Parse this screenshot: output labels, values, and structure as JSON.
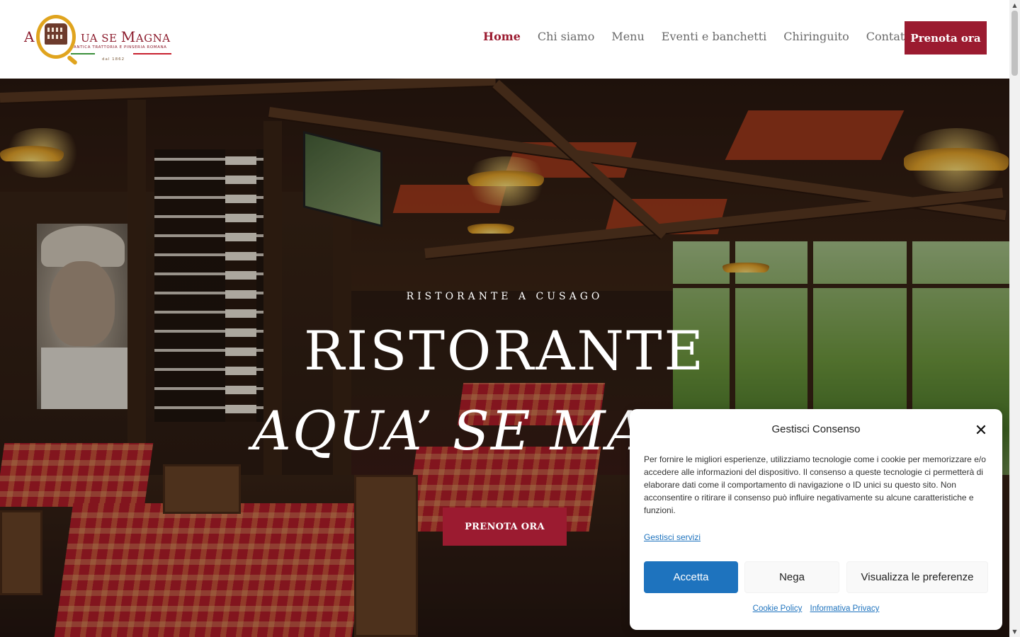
{
  "header": {
    "logo": {
      "a": "A",
      "name_first": "UA SE ",
      "name_m": "M",
      "name_rest": "AGNA",
      "tagline": "ANTICA TRATTORIA E PINSERIA ROMANA",
      "since": "dal 1862"
    },
    "nav": [
      {
        "label": "Home",
        "active": true
      },
      {
        "label": "Chi siamo",
        "active": false
      },
      {
        "label": "Menu",
        "active": false
      },
      {
        "label": "Eventi e banchetti",
        "active": false
      },
      {
        "label": "Chiringuito",
        "active": false
      },
      {
        "label": "Contatti",
        "active": false
      }
    ],
    "cta_label": "Prenota ora"
  },
  "hero": {
    "eyebrow": "RISTORANTE A CUSAGO",
    "title_line1": "RISTORANTE",
    "title_line2": "AQUA’ SE MA",
    "button_label": "PRENOTA ORA"
  },
  "consent": {
    "title": "Gestisci Consenso",
    "body": "Per fornire le migliori esperienze, utilizziamo tecnologie come i cookie per memorizzare e/o accedere alle informazioni del dispositivo. Il consenso a queste tecnologie ci permetterà di elaborare dati come il comportamento di navigazione o ID unici su questo sito. Non acconsentire o ritirare il consenso può influire negativamente su alcune caratteristiche e funzioni.",
    "manage_link": "Gestisci servizi",
    "accept_label": "Accetta",
    "deny_label": "Nega",
    "prefs_label": "Visualizza le preferenze",
    "links": [
      "Cookie Policy",
      "Informativa Privacy"
    ]
  },
  "colors": {
    "brand": "#9b1b30",
    "consent_accent": "#1e73be",
    "logo_gold": "#e0a41e"
  },
  "icons": {
    "close": "close-icon",
    "scroll_up": "triangle-up-icon",
    "scroll_down": "triangle-down-icon"
  }
}
